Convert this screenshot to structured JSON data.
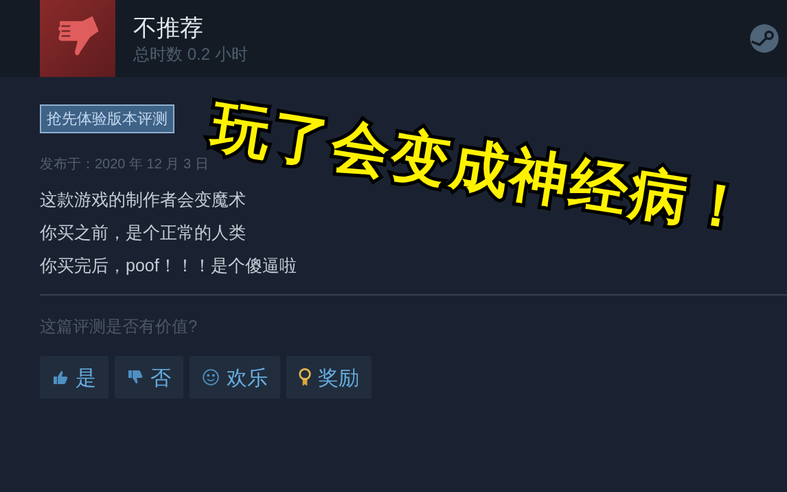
{
  "review": {
    "verdict": {
      "kind": "not_recommended",
      "label": "不推荐"
    },
    "playtime": "总时数 0.2 小时",
    "badge": "抢先体验版本评测",
    "posted": "发布于：2020 年 12 月 3 日",
    "body_lines": [
      "这款游戏的制作者会变魔术",
      "你买之前，是个正常的人类",
      "你买完后，poof！！！是个傻逼啦"
    ],
    "helpful_prompt": "这篇评测是否有价值?",
    "buttons": [
      {
        "kind": "yes",
        "label": "是"
      },
      {
        "kind": "no",
        "label": "否"
      },
      {
        "kind": "funny",
        "label": "欢乐"
      },
      {
        "kind": "award",
        "label": "奖励"
      }
    ]
  },
  "caption": "玩了会变成神经病！"
}
